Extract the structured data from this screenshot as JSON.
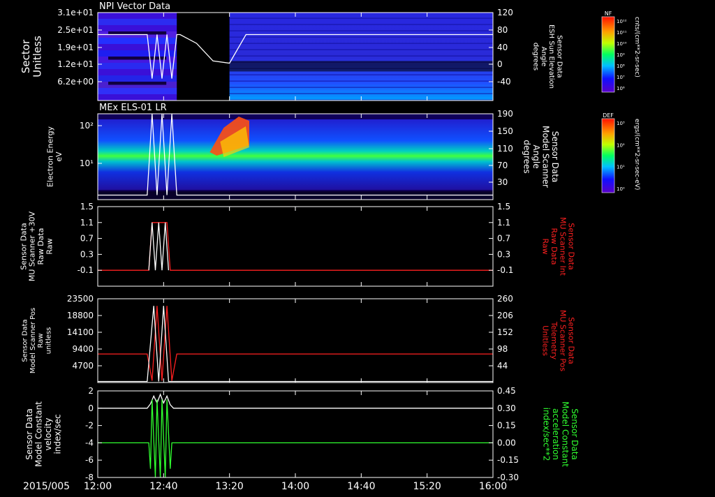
{
  "date_label": "2015/005",
  "time_ticks": [
    "12:00",
    "12:40",
    "13:20",
    "14:00",
    "14:40",
    "15:20",
    "16:00"
  ],
  "colorbars": {
    "nf": {
      "label": "NF",
      "unit": "cnts/(cm**2-sr-sec)",
      "ticks": [
        "10¹²",
        "10¹¹",
        "10¹⁰",
        "10⁹",
        "10⁸",
        "10⁷",
        "10⁶"
      ]
    },
    "def": {
      "label": "DEF",
      "unit": "ergs/(cm**2-sr-sec-eV)",
      "ticks": [
        "10³",
        "10²",
        "10¹",
        "10⁰"
      ]
    }
  },
  "chart_data": [
    {
      "type": "heatmap",
      "title": "NPI Vector Data",
      "ylabel": [
        "Sector",
        "Unitless"
      ],
      "yticks_left": [
        "3.1e+01",
        "2.5e+01",
        "1.9e+01",
        "1.2e+01",
        "6.2e+00"
      ],
      "y2label": [
        "Sensor Data",
        "ESH Sun Elevation",
        "Angle",
        "degrees"
      ],
      "yticks_right": [
        "120",
        "80",
        "40",
        "0",
        "-40"
      ],
      "ylim_right": [
        -80,
        120
      ],
      "overlay_line": {
        "color": "#ffffff",
        "x": [
          "12:00",
          "12:30",
          "12:33",
          "12:36",
          "12:39",
          "12:42",
          "12:45",
          "12:48",
          "12:50",
          "13:00",
          "13:10",
          "13:20",
          "13:30",
          "16:00"
        ],
        "y": [
          70,
          70,
          -30,
          70,
          -30,
          70,
          -30,
          70,
          70,
          50,
          10,
          5,
          70,
          70
        ]
      },
      "colorbar": "NF"
    },
    {
      "type": "heatmap",
      "title": "MEx ELS-01 LR",
      "ylabel": [
        "Electron Energy",
        "eV"
      ],
      "yticks_left": [
        "10²",
        "10¹"
      ],
      "y2label": [
        "Sensor Data",
        "Model Scanner",
        "Angle",
        "degrees"
      ],
      "yticks_right": [
        "190",
        "150",
        "110",
        "70",
        "30"
      ],
      "ylim_right": [
        0,
        190
      ],
      "overlay_line": {
        "color": "#ffffff",
        "x": [
          "12:00",
          "12:30",
          "12:33",
          "12:36",
          "12:39",
          "12:42",
          "12:45",
          "12:48",
          "13:00",
          "16:00"
        ],
        "y": [
          10,
          10,
          190,
          10,
          190,
          10,
          190,
          10,
          10,
          10
        ]
      },
      "colorbar": "DEF"
    },
    {
      "type": "line",
      "ylabel": [
        "Sensor Data",
        "MU Scanner +30V",
        "Raw Data",
        "Raw"
      ],
      "yticks_left": [
        "1.5",
        "1.1",
        "0.7",
        "0.3",
        "-0.1"
      ],
      "ylim": [
        -0.5,
        1.5
      ],
      "y2label": [
        "Sensor Data",
        "MU Scanner Int",
        "Raw Data",
        "Raw"
      ],
      "yticks_right": [
        "1.5",
        "1.1",
        "0.7",
        "0.3",
        "-0.1"
      ],
      "series": [
        {
          "color": "#ff2020",
          "x": [
            "12:00",
            "12:31",
            "12:33",
            "12:42",
            "12:44",
            "16:00"
          ],
          "y": [
            -0.1,
            -0.1,
            1.1,
            1.1,
            -0.1,
            -0.1
          ]
        },
        {
          "color": "#ffffff",
          "x": [
            "12:31",
            "12:33",
            "12:35",
            "12:37",
            "12:39",
            "12:41",
            "12:43"
          ],
          "y": [
            -0.1,
            1.1,
            -0.1,
            1.1,
            -0.1,
            1.1,
            -0.1
          ]
        }
      ]
    },
    {
      "type": "line",
      "ylabel": [
        "Sensor Data",
        "Model Scanner Pos",
        "Raw",
        "unitless"
      ],
      "yticks_left": [
        "23500",
        "18800",
        "14100",
        "9400",
        "4700"
      ],
      "ylim": [
        0,
        23500
      ],
      "y2label": [
        "Sensor Data",
        "MU Scanner Pos",
        "Telemetry",
        "Unitless"
      ],
      "yticks_right": [
        "260",
        "206",
        "152",
        "98",
        "44"
      ],
      "series": [
        {
          "color": "#ff2020",
          "x": [
            "12:00",
            "12:30",
            "12:33",
            "12:36",
            "12:39",
            "12:42",
            "12:45",
            "12:48",
            "16:00"
          ],
          "y": [
            8000,
            8000,
            500,
            21500,
            500,
            21500,
            500,
            8000,
            8000
          ]
        },
        {
          "color": "#ffffff",
          "x": [
            "12:00",
            "12:30",
            "12:34",
            "12:37",
            "12:40",
            "12:43",
            "12:46",
            "16:00"
          ],
          "y": [
            300,
            300,
            21500,
            300,
            21500,
            300,
            300,
            300
          ]
        }
      ]
    },
    {
      "type": "line",
      "ylabel": [
        "Sensor Data",
        "Model Constant",
        "velocity",
        "index/sec"
      ],
      "yticks_left": [
        "2",
        "0",
        "-2",
        "-4",
        "-6",
        "-8"
      ],
      "ylim": [
        -8,
        2
      ],
      "y2label": [
        "Sensor Data",
        "Model Constant",
        "acceleration",
        "index/sec**2"
      ],
      "yticks_right": [
        "0.45",
        "0.30",
        "0.15",
        "0.00",
        "-0.15",
        "-0.30"
      ],
      "series": [
        {
          "color": "#ffffff",
          "x": [
            "12:00",
            "12:30",
            "12:32",
            "12:34",
            "12:36",
            "12:38",
            "12:40",
            "12:42",
            "12:44",
            "12:46",
            "16:00"
          ],
          "y": [
            0,
            0,
            0.5,
            1.4,
            0.6,
            1.6,
            0.6,
            1.4,
            0.4,
            0,
            0
          ]
        },
        {
          "color": "#30ff30",
          "x": [
            "12:00",
            "12:31",
            "12:32",
            "12:33",
            "12:35",
            "12:36",
            "12:38",
            "12:39",
            "12:41",
            "12:42",
            "12:44",
            "12:45",
            "16:00"
          ],
          "y": [
            -4,
            -4,
            -7,
            1,
            -8,
            1,
            -8,
            1,
            -8,
            1,
            -7,
            -4,
            -4
          ]
        }
      ]
    }
  ]
}
